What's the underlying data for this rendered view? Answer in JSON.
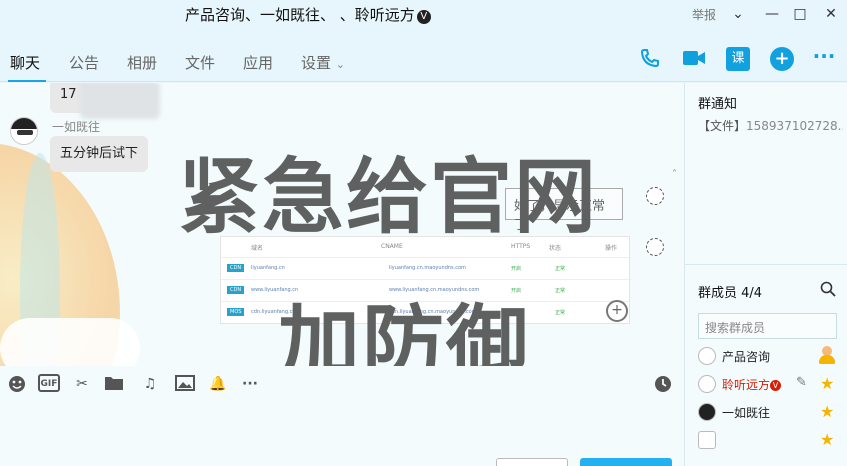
{
  "window": {
    "title": "产品咨询、一如既往、    、聆听远方",
    "title_badge": "V",
    "report": "举报",
    "controls": [
      "chevron-down",
      "minimize",
      "maximize",
      "close"
    ]
  },
  "tabs": [
    {
      "label": "聊天",
      "active": true
    },
    {
      "label": "公告"
    },
    {
      "label": "相册"
    },
    {
      "label": "文件"
    },
    {
      "label": "应用"
    },
    {
      "label": "设置"
    }
  ],
  "header_tools": {
    "class_label": "课",
    "icons": [
      "phone-icon",
      "video-icon",
      "class-icon",
      "add-icon",
      "more-icon"
    ],
    "accent": "#12a0df"
  },
  "chat": {
    "messages": [
      {
        "text": "17",
        "blurred": true
      },
      {
        "sender": "一如既往",
        "text": "五分钟后试下"
      }
    ],
    "overlay": {
      "line1": "紧急给官网",
      "line2": "加防御",
      "tooltip": "好了，显示正常了",
      "table": {
        "headers": [
          "域名",
          "CNAME",
          "HTTPS",
          "状态",
          "操作"
        ],
        "rows": [
          {
            "badge": "CDN",
            "domain": "liyuanfang.cn",
            "cname": "liyuanfang.cn.maoyundns.com",
            "https": "开启",
            "status": "正常"
          },
          {
            "badge": "CDN",
            "domain": "www.liyuanfang.cn",
            "cname": "www.liyuanfang.cn.maoyundns.com",
            "https": "开启",
            "status": "正常"
          },
          {
            "badge": "MOS",
            "domain": "cdn.liyuanfang.cn",
            "cname": "cdn.liyuanfang.cn.maoyundns.com",
            "https": "",
            "status": "正常"
          }
        ]
      }
    }
  },
  "input_toolbar": {
    "gif_label": "GIF",
    "icons": [
      "emoji-icon",
      "gif-icon",
      "scissors-icon",
      "folder-icon",
      "music-icon",
      "image-icon",
      "bell-icon",
      "more-icon",
      "history-icon"
    ]
  },
  "right_panel": {
    "notice_title": "群通知",
    "notice_tag": "【文件】",
    "notice_text": "158937102728...",
    "members_title": "群成员 4/4",
    "search_placeholder": "搜索群成员",
    "members": [
      {
        "name": "产品咨询",
        "role": "owner"
      },
      {
        "name": "聆听远方",
        "verified": true,
        "role": "admin",
        "highlight": "#d81e06"
      },
      {
        "name": "一如既往",
        "role": "admin"
      },
      {
        "name": "",
        "role": "admin"
      }
    ]
  }
}
